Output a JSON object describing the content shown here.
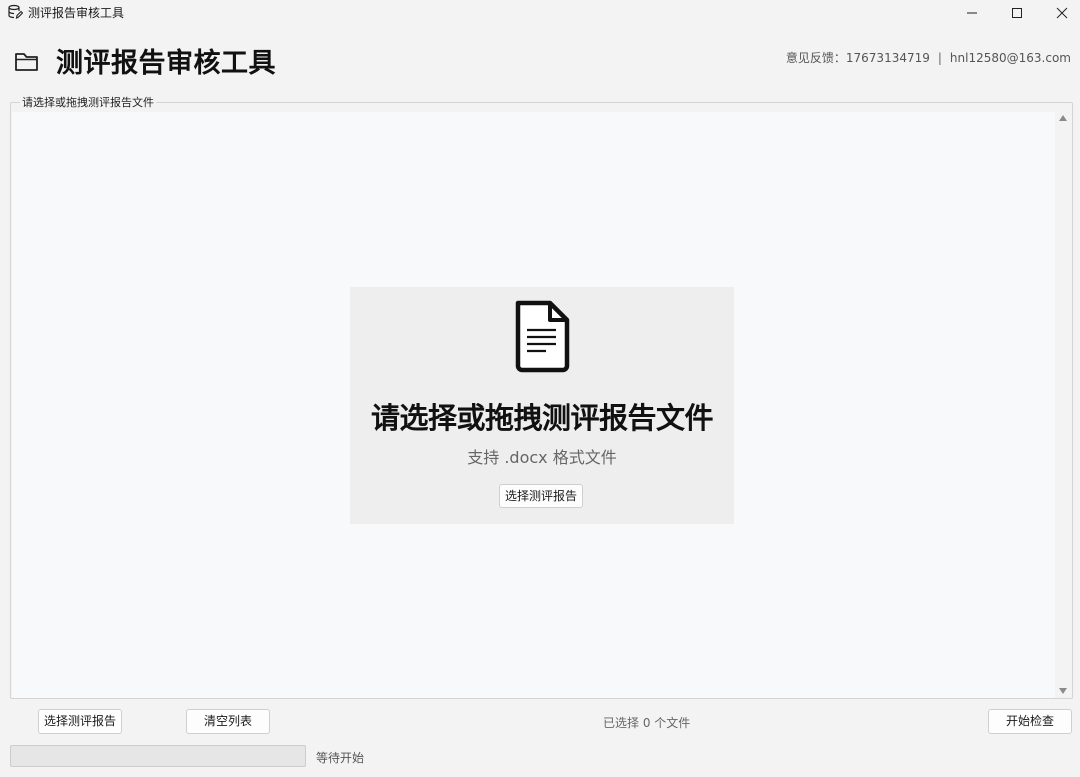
{
  "window": {
    "title": "测评报告审核工具",
    "icon": "database-edit-icon"
  },
  "header": {
    "title": "测评报告审核工具",
    "icon": "folder-icon",
    "feedback_label": "意见反馈：17673134719",
    "separator": "|",
    "email": "hnl12580@163.com"
  },
  "file_group": {
    "legend": "请选择或拖拽测评报告文件",
    "files": [],
    "dropzone": {
      "icon": "document-icon",
      "title": "请选择或拖拽测评报告文件",
      "subtitle": "支持 .docx 格式文件",
      "button_label": "选择测评报告"
    }
  },
  "controls": {
    "select_label": "选择测评报告",
    "clear_label": "清空列表",
    "selected_count": "已选择 0 个文件",
    "start_label": "开始检查"
  },
  "progress": {
    "value": 0,
    "status": "等待开始"
  }
}
